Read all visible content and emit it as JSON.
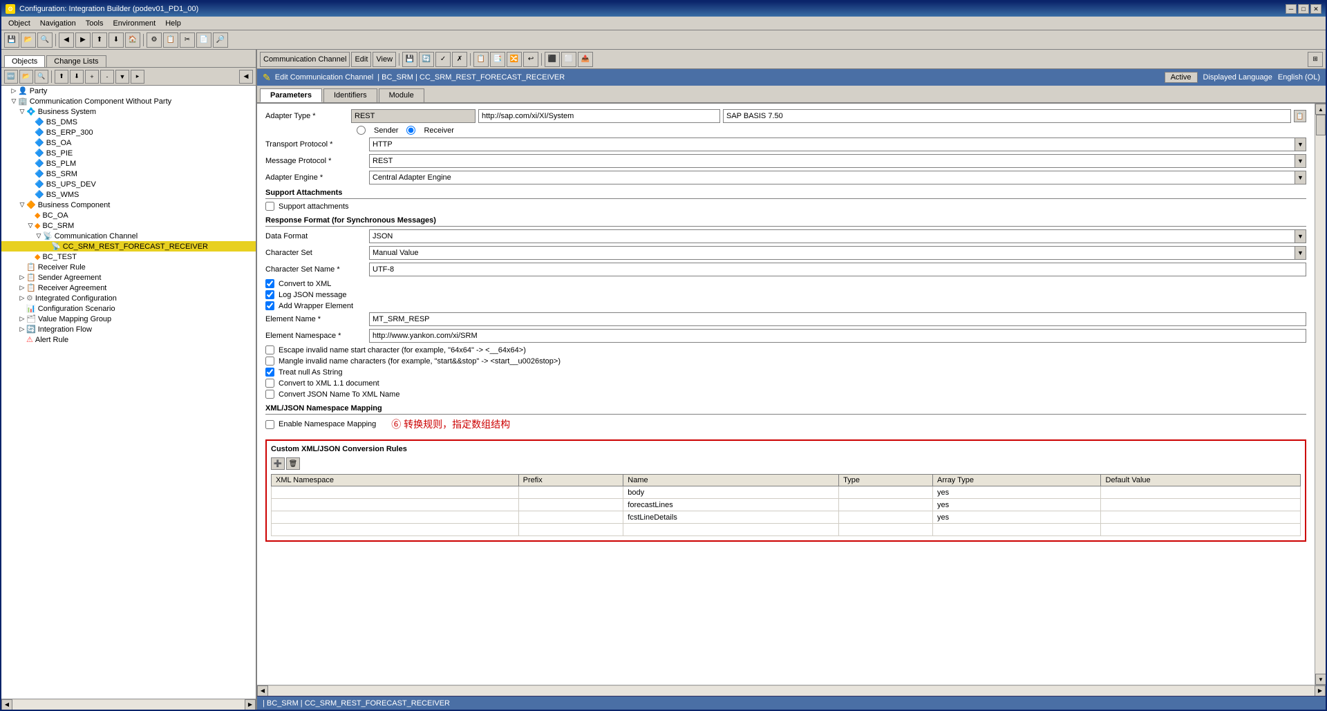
{
  "window": {
    "title": "Configuration: Integration Builder (podev01_PD1_00)",
    "icon": "⚙"
  },
  "menubar": {
    "items": [
      "Object",
      "Navigation",
      "Tools",
      "Environment",
      "Help"
    ]
  },
  "left_panel": {
    "tabs": [
      "Objects",
      "Change Lists"
    ],
    "active_tab": "Objects",
    "toolbar_buttons": [
      "new",
      "open",
      "search",
      "filter",
      "sort",
      "move_up",
      "move_down",
      "expand",
      "collapse",
      "more"
    ],
    "tree": [
      {
        "label": "Party",
        "level": 0,
        "type": "folder",
        "expanded": false
      },
      {
        "label": "Communication Component Without Party",
        "level": 0,
        "type": "folder",
        "expanded": true
      },
      {
        "label": "Business System",
        "level": 1,
        "type": "folder",
        "expanded": true
      },
      {
        "label": "BS_DMS",
        "level": 2,
        "type": "item"
      },
      {
        "label": "BS_ERP_300",
        "level": 2,
        "type": "item"
      },
      {
        "label": "BS_OA",
        "level": 2,
        "type": "item"
      },
      {
        "label": "BS_PIE",
        "level": 2,
        "type": "item"
      },
      {
        "label": "BS_PLM",
        "level": 2,
        "type": "item"
      },
      {
        "label": "BS_SRM",
        "level": 2,
        "type": "item"
      },
      {
        "label": "BS_UPS_DEV",
        "level": 2,
        "type": "item"
      },
      {
        "label": "BS_WMS",
        "level": 2,
        "type": "item"
      },
      {
        "label": "Business Component",
        "level": 1,
        "type": "folder",
        "expanded": true
      },
      {
        "label": "BC_OA",
        "level": 2,
        "type": "item"
      },
      {
        "label": "BC_SRM",
        "level": 2,
        "type": "folder",
        "expanded": true
      },
      {
        "label": "Communication Channel",
        "level": 3,
        "type": "folder",
        "expanded": true
      },
      {
        "label": "CC_SRM_REST_FORECAST_RECEIVER",
        "level": 4,
        "type": "channel",
        "selected": true,
        "highlighted": true
      },
      {
        "label": "BC_TEST",
        "level": 2,
        "type": "item"
      },
      {
        "label": "Receiver Rule",
        "level": 1,
        "type": "item"
      },
      {
        "label": "Sender Agreement",
        "level": 1,
        "type": "item"
      },
      {
        "label": "Receiver Agreement",
        "level": 1,
        "type": "item"
      },
      {
        "label": "Integrated Configuration",
        "level": 1,
        "type": "item"
      },
      {
        "label": "Configuration Scenario",
        "level": 1,
        "type": "item"
      },
      {
        "label": "Value Mapping Group",
        "level": 1,
        "type": "item"
      },
      {
        "label": "Integration Flow",
        "level": 1,
        "type": "item"
      },
      {
        "label": "Alert Rule",
        "level": 1,
        "type": "item"
      }
    ]
  },
  "right_panel": {
    "toolbar": {
      "menu_items": [
        "Communication Channel",
        "Edit",
        "View"
      ],
      "buttons": [
        "save",
        "refresh",
        "back",
        "forward",
        "display_mode",
        "layout1",
        "layout2",
        "layout3",
        "btn4",
        "btn5",
        "btn6"
      ]
    },
    "edit_header": {
      "icon": "✎",
      "label": "Edit Communication Channel",
      "path": "| BC_SRM | CC_SRM_REST_FORECAST_RECEIVER",
      "status": "Active",
      "display_language_label": "Displayed Language",
      "display_language_value": "English (OL)"
    },
    "tabs": {
      "items": [
        "Parameters",
        "Identifiers",
        "Module"
      ],
      "active": "Parameters"
    },
    "form": {
      "adapter_type_label": "Adapter Type *",
      "adapter_type_value": "REST",
      "adapter_url1": "http://sap.com/xi/XI/System",
      "adapter_basis": "SAP BASIS 7.50",
      "sender_label": "Sender",
      "receiver_label": "Receiver",
      "transport_protocol_label": "Transport Protocol *",
      "transport_protocol_value": "HTTP",
      "message_protocol_label": "Message Protocol *",
      "message_protocol_value": "REST",
      "adapter_engine_label": "Adapter Engine *",
      "adapter_engine_value": "Central Adapter Engine",
      "support_attachments_label": "Support Attachments",
      "support_attachments_checkbox": "Support attachments",
      "response_format_header": "Response Format (for Synchronous Messages)",
      "data_format_label": "Data Format",
      "data_format_value": "JSON",
      "character_set_label": "Character Set",
      "character_set_value": "Manual Value",
      "character_set_name_label": "Character Set Name *",
      "character_set_name_value": "UTF-8",
      "checkboxes": [
        {
          "id": "convert_xml",
          "label": "Convert to XML",
          "checked": true
        },
        {
          "id": "log_json",
          "label": "Log JSON message",
          "checked": true
        },
        {
          "id": "add_wrapper",
          "label": "Add Wrapper Element",
          "checked": true
        }
      ],
      "element_name_label": "Element Name *",
      "element_name_value": "MT_SRM_RESP",
      "element_namespace_label": "Element Namespace *",
      "element_namespace_value": "http://www.yankon.com/xi/SRM",
      "checkboxes2": [
        {
          "id": "escape_invalid",
          "label": "Escape invalid name start character (for example, \"64x64\" -> <__64x64>)",
          "checked": false
        },
        {
          "id": "mangle_invalid",
          "label": "Mangle invalid name characters (for example, \"start&&stop\" -> <start__u0026stop>)",
          "checked": false
        },
        {
          "id": "treat_null",
          "label": "Treat null As String",
          "checked": true
        },
        {
          "id": "convert_xml11",
          "label": "Convert to XML 1.1 document",
          "checked": false
        },
        {
          "id": "convert_json_name",
          "label": "Convert JSON Name To XML Name",
          "checked": false
        }
      ],
      "namespace_mapping_header": "XML/JSON Namespace Mapping",
      "enable_namespace_label": "Enable Namespace Mapping",
      "enable_namespace_checked": false,
      "annotation": "⑥ 转换规则，指定数组结构"
    },
    "custom_table": {
      "header": "Custom XML/JSON Conversion Rules",
      "columns": [
        "XML Namespace",
        "Prefix",
        "Name",
        "Type",
        "Array Type",
        "Default Value"
      ],
      "rows": [
        {
          "xml_namespace": "",
          "prefix": "",
          "name": "body",
          "type": "",
          "array_type": "yes",
          "default_value": ""
        },
        {
          "xml_namespace": "",
          "prefix": "",
          "name": "forecastLines",
          "type": "",
          "array_type": "yes",
          "default_value": ""
        },
        {
          "xml_namespace": "",
          "prefix": "",
          "name": "fcstLineDetails",
          "type": "",
          "array_type": "yes",
          "default_value": ""
        },
        {
          "xml_namespace": "",
          "prefix": "",
          "name": "",
          "type": "",
          "array_type": "",
          "default_value": ""
        }
      ]
    },
    "status_bar": {
      "text": "| BC_SRM | CC_SRM_REST_FORECAST_RECEIVER"
    }
  }
}
